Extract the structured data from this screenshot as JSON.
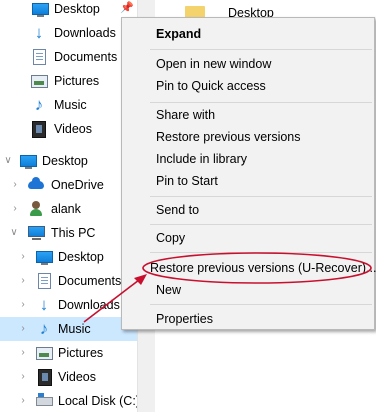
{
  "nav": {
    "quick_access": [
      {
        "label": "Desktop",
        "icon": "desktop-icon",
        "pinned": true
      },
      {
        "label": "Downloads",
        "icon": "downloads-icon"
      },
      {
        "label": "Documents",
        "icon": "documents-icon"
      },
      {
        "label": "Pictures",
        "icon": "pictures-icon"
      },
      {
        "label": "Music",
        "icon": "music-icon"
      },
      {
        "label": "Videos",
        "icon": "videos-icon"
      }
    ],
    "desktop": {
      "label": "Desktop",
      "icon": "desktop-icon",
      "expanded": true
    },
    "desktop_children": [
      {
        "label": "OneDrive",
        "icon": "onedrive-icon",
        "expanded": false
      },
      {
        "label": "alank",
        "icon": "user-icon",
        "expanded": false
      },
      {
        "label": "This PC",
        "icon": "this-pc-icon",
        "expanded": true
      }
    ],
    "this_pc_children": [
      {
        "label": "Desktop",
        "icon": "desktop-icon"
      },
      {
        "label": "Documents",
        "icon": "documents-icon"
      },
      {
        "label": "Downloads",
        "icon": "downloads-icon"
      },
      {
        "label": "Music",
        "icon": "music-icon",
        "selected": true
      },
      {
        "label": "Pictures",
        "icon": "pictures-icon"
      },
      {
        "label": "Videos",
        "icon": "videos-icon"
      },
      {
        "label": "Local Disk (C:)",
        "icon": "local-disk-icon"
      }
    ]
  },
  "content": {
    "items": [
      {
        "label": "Desktop",
        "icon": "folder-icon"
      }
    ]
  },
  "context_menu": {
    "groups": [
      [
        {
          "label": "Expand",
          "bold": true
        }
      ],
      [
        {
          "label": "Open in new window"
        },
        {
          "label": "Pin to Quick access"
        }
      ],
      [
        {
          "label": "Share with"
        },
        {
          "label": "Restore previous versions"
        },
        {
          "label": "Include in library"
        },
        {
          "label": "Pin to Start"
        }
      ],
      [
        {
          "label": "Send to"
        }
      ],
      [
        {
          "label": "Copy"
        }
      ],
      [
        {
          "label": "Restore previous versions (U-Recover)...",
          "highlighted": true
        },
        {
          "label": "New"
        }
      ],
      [
        {
          "label": "Properties"
        }
      ]
    ]
  },
  "colors": {
    "selection": "#cce8ff",
    "annotation": "#c8102e",
    "menu_background": "#f2f2f2"
  }
}
